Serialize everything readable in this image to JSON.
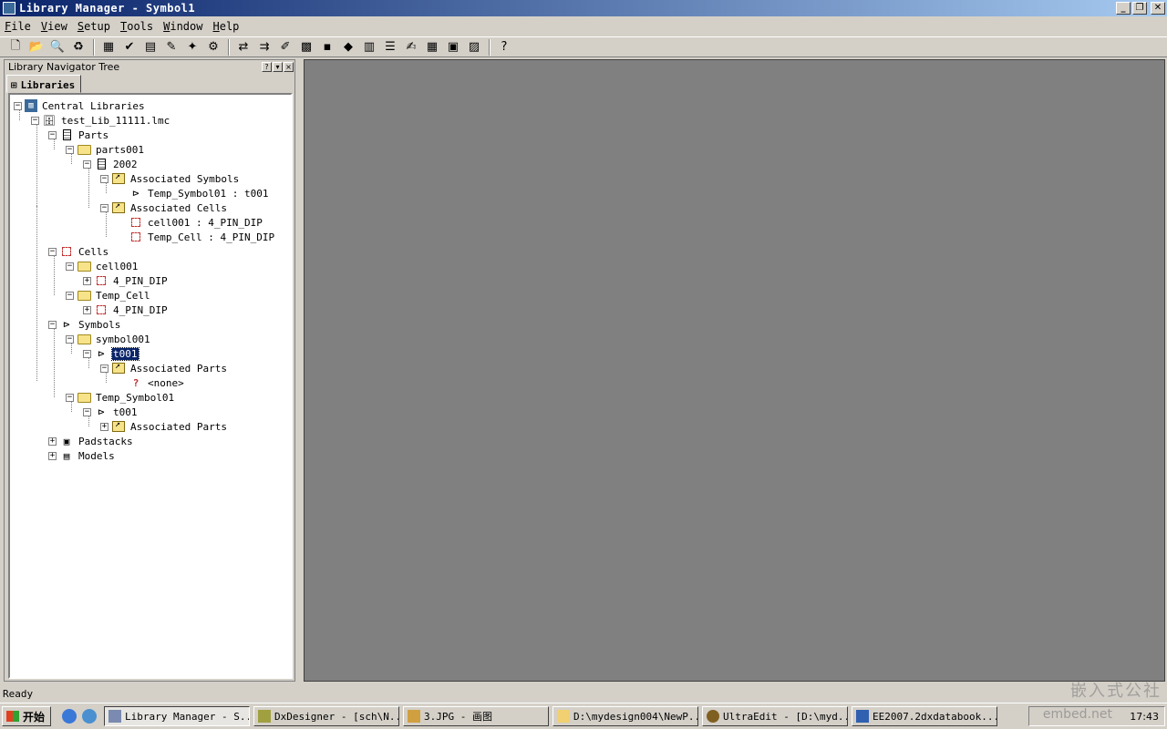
{
  "window": {
    "title": "Library Manager - Symbol1"
  },
  "menu": [
    {
      "label": "File",
      "key": "F",
      "rest": "ile"
    },
    {
      "label": "View",
      "key": "V",
      "rest": "iew"
    },
    {
      "label": "Setup",
      "key": "S",
      "rest": "etup"
    },
    {
      "label": "Tools",
      "key": "T",
      "rest": "ools"
    },
    {
      "label": "Window",
      "key": "W",
      "rest": "indow"
    },
    {
      "label": "Help",
      "key": "H",
      "rest": "elp"
    }
  ],
  "panel": {
    "title": "Library Navigator Tree",
    "tab": "Libraries"
  },
  "tree": {
    "n1": "Central Libraries",
    "n2": "test_Lib_11111.lmc",
    "n3": "Parts",
    "n4": "parts001",
    "n5": "2002",
    "n6": "Associated Symbols",
    "n7": "Temp_Symbol01 : t001",
    "n8": "Associated Cells",
    "n9": "cell001 : 4_PIN_DIP",
    "n10": "Temp_Cell : 4_PIN_DIP",
    "n11": "Cells",
    "n12": "cell001",
    "n13": "4_PIN_DIP",
    "n14": "Temp_Cell",
    "n15": "4_PIN_DIP",
    "n16": "Symbols",
    "n17": "symbol001",
    "n18": "t001",
    "n19": "Associated Parts",
    "n20": "<none>",
    "n21": "Temp_Symbol01",
    "n22": "t001",
    "n23": "Associated Parts",
    "n24": "Padstacks",
    "n25": "Models"
  },
  "status": {
    "text": "Ready"
  },
  "taskbar": {
    "start": "开始",
    "tasks": [
      "Library Manager - S...",
      "DxDesigner - [sch\\N...",
      "3.JPG - 画图",
      "D:\\mydesign004\\NewP...",
      "UltraEdit - [D:\\myd...",
      "EE2007.2dxdatabook..."
    ],
    "clock": "17:43"
  },
  "watermark": {
    "line1": "嵌入式公社",
    "line2": "embed.net"
  }
}
